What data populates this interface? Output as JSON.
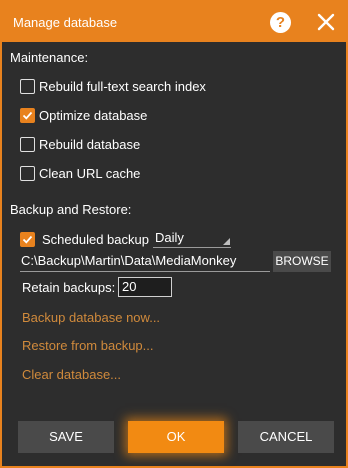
{
  "window": {
    "title": "Manage database",
    "help_glyph": "?"
  },
  "maintenance": {
    "heading": "Maintenance:",
    "items": [
      {
        "label": "Rebuild full-text search index",
        "checked": false
      },
      {
        "label": "Optimize database",
        "checked": true
      },
      {
        "label": "Rebuild database",
        "checked": false
      },
      {
        "label": "Clean URL cache",
        "checked": false
      }
    ]
  },
  "backup": {
    "heading": "Backup and Restore:",
    "scheduled_label": "Scheduled backup",
    "scheduled_checked": true,
    "frequency": "Daily",
    "path": "C:\\Backup\\Martin\\Data\\MediaMonkey",
    "browse_label": "BROWSE",
    "retain_label": "Retain backups:",
    "retain_value": "20",
    "links": {
      "backup_now": "Backup database now...",
      "restore": "Restore from backup...",
      "clear": "Clear database..."
    }
  },
  "buttons": {
    "save": "SAVE",
    "ok": "OK",
    "cancel": "CANCEL"
  },
  "colors": {
    "accent": "#e8821e",
    "link": "#d08a3c",
    "background": "#2d2d2d"
  },
  "icons": {
    "help": "help-icon",
    "close": "close-icon",
    "check": "check-icon"
  }
}
